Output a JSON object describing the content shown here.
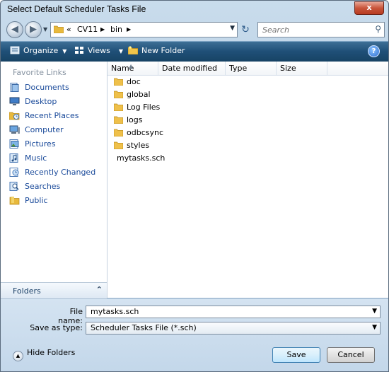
{
  "window": {
    "title": "Select Default  Scheduler Tasks File",
    "close_label": "x"
  },
  "address": {
    "crumbs": [
      "«",
      "CV11",
      "bin"
    ]
  },
  "search": {
    "placeholder": "Search"
  },
  "toolbar": {
    "organize": "Organize",
    "views": "Views",
    "new_folder": "New Folder",
    "help": "?"
  },
  "nav": {
    "favorites_title": "Favorite Links",
    "items": [
      {
        "label": "Documents",
        "icon": "documents-icon"
      },
      {
        "label": "Desktop",
        "icon": "desktop-icon"
      },
      {
        "label": "Recent Places",
        "icon": "recent-places-icon"
      },
      {
        "label": "Computer",
        "icon": "computer-icon"
      },
      {
        "label": "Pictures",
        "icon": "pictures-icon"
      },
      {
        "label": "Music",
        "icon": "music-icon"
      },
      {
        "label": "Recently Changed",
        "icon": "recently-changed-icon"
      },
      {
        "label": "Searches",
        "icon": "searches-icon"
      },
      {
        "label": "Public",
        "icon": "public-folder-icon"
      }
    ],
    "folders_label": "Folders"
  },
  "columns": {
    "name": "Name",
    "date": "Date modified",
    "type": "Type",
    "size": "Size"
  },
  "files": [
    {
      "name": "doc",
      "kind": "folder"
    },
    {
      "name": "global",
      "kind": "folder"
    },
    {
      "name": "Log Files",
      "kind": "folder"
    },
    {
      "name": "logs",
      "kind": "folder"
    },
    {
      "name": "odbcsync",
      "kind": "folder"
    },
    {
      "name": "styles",
      "kind": "folder"
    },
    {
      "name": "mytasks.sch",
      "kind": "file"
    }
  ],
  "form": {
    "file_name_label": "File name:",
    "file_name_value": "mytasks.sch",
    "save_as_type_label": "Save as type:",
    "save_as_type_value": "Scheduler Tasks File (*.sch)"
  },
  "footer": {
    "hide_folders": "Hide Folders",
    "save": "Save",
    "cancel": "Cancel"
  }
}
